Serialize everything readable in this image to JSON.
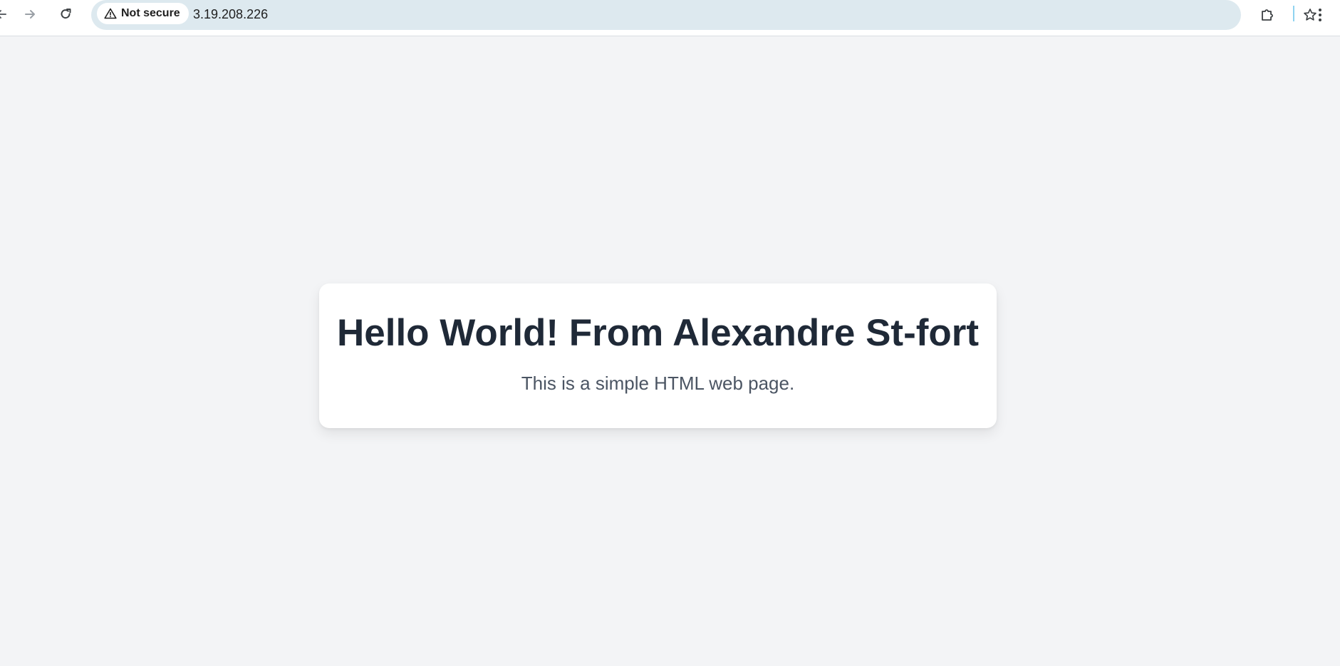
{
  "browser": {
    "security_label": "Not secure",
    "url": "3.19.208.226",
    "icons": {
      "back": "arrow-left-icon",
      "forward": "arrow-right-icon",
      "reload": "reload-icon",
      "warning": "warning-triangle-icon",
      "bookmark": "star-icon",
      "extensions": "puzzle-icon",
      "menu": "kebab-menu-icon"
    }
  },
  "page": {
    "heading": "Hello World! From Alexandre St-fort",
    "subtitle": "This is a simple HTML web page."
  },
  "colors": {
    "page_background": "#f3f4f6",
    "card_background": "#ffffff",
    "heading": "#1f2937",
    "subtitle": "#4b5563",
    "omnibox": "#dde9ef"
  }
}
